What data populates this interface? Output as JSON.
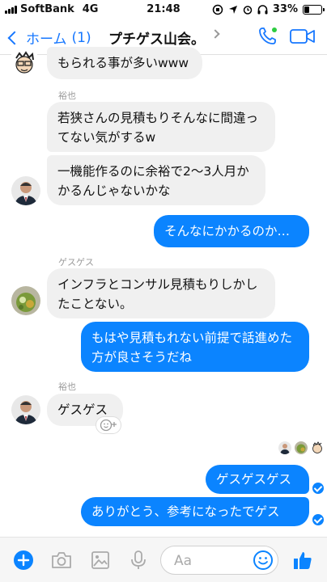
{
  "status_bar": {
    "carrier": "SoftBank",
    "network": "4G",
    "time": "21:48",
    "battery": "33%",
    "battery_level": 0.33
  },
  "nav": {
    "back_label": "ホーム",
    "unread_count": "(1)",
    "title": "プチゲス山会。",
    "accent_color": "#1677ff"
  },
  "messages": [
    {
      "text": "もられる事が多いwww",
      "direction": "in"
    },
    {
      "sender": "裕也",
      "text": "若狭さんの見積もりそんなに間違ってない気がするw",
      "direction": "in"
    },
    {
      "text": "一機能作るのに余裕で2〜3人月かかるんじゃないかな",
      "direction": "in"
    },
    {
      "text": "そんなにかかるのか…",
      "direction": "out"
    },
    {
      "sender": "ゲスゲス",
      "text": "インフラとコンサル見積もりしかしたことない。",
      "direction": "in"
    },
    {
      "text": "もはや見積もれない前提で話進めた方が良さそうだね",
      "direction": "out"
    },
    {
      "sender": "裕也",
      "text": "ゲスゲス",
      "direction": "in"
    },
    {
      "text": "ゲスゲスゲス",
      "direction": "out"
    },
    {
      "text": "ありがとう、参考になったでゲス",
      "direction": "out"
    }
  ],
  "composer": {
    "placeholder": "Aa"
  },
  "colors": {
    "outgoing_bubble": "#0b84ff",
    "incoming_bubble": "#f0f0f0"
  }
}
